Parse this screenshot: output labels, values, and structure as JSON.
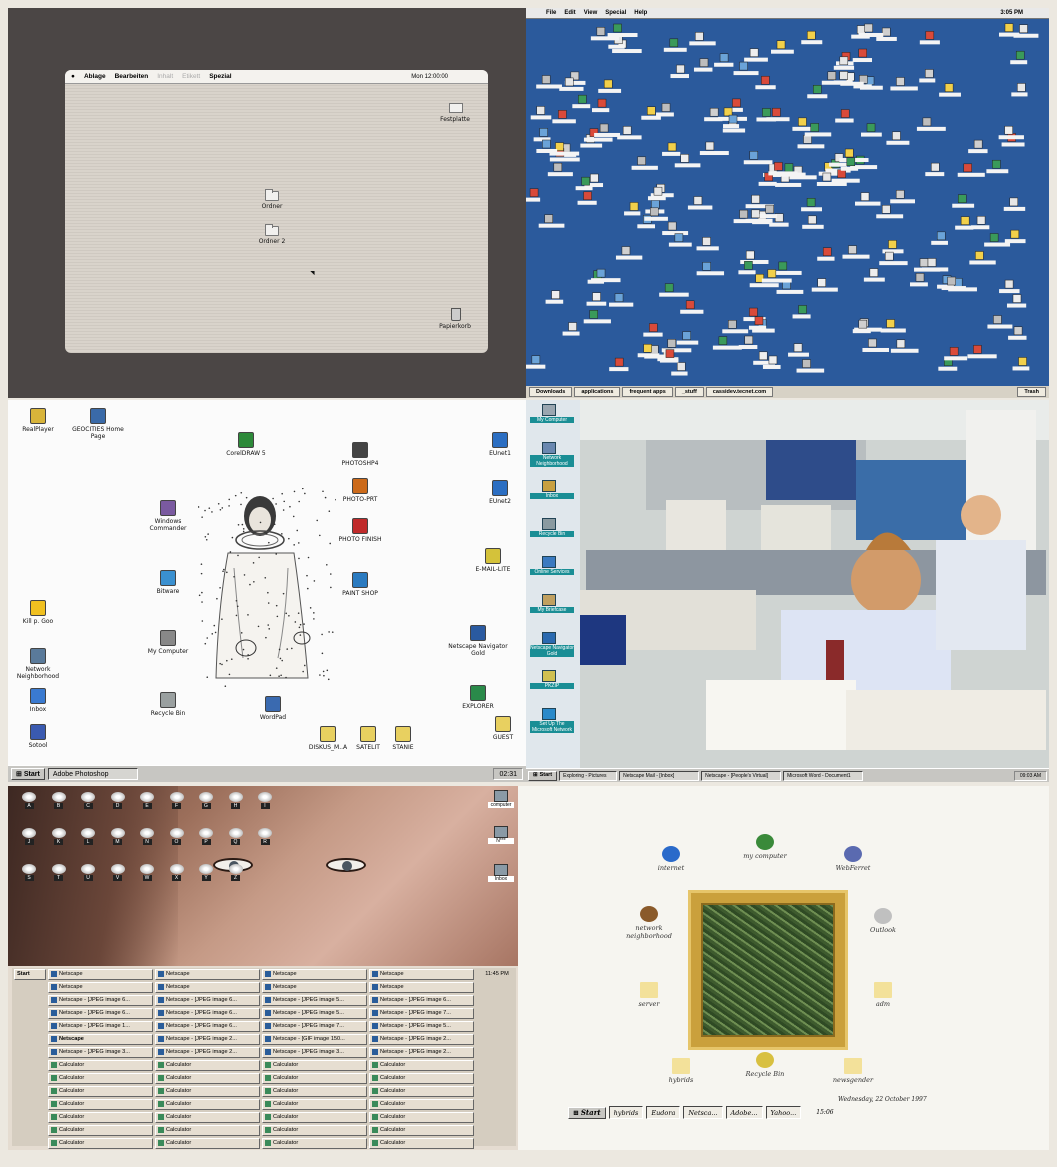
{
  "mac1": {
    "menu": [
      "Ablage",
      "Bearbeiten",
      "Inhalt",
      "Etikett",
      "Spezial"
    ],
    "menu_dim": [
      false,
      false,
      true,
      true,
      false
    ],
    "clock": "Mon 12:00:00",
    "icons": [
      "Festplatte",
      "Ordner",
      "Ordner 2",
      "Papierkorb"
    ]
  },
  "mac2": {
    "menu": [
      "File",
      "Edit",
      "View",
      "Special",
      "Help"
    ],
    "time": "3:05 PM",
    "tabs": [
      "Downloads",
      "applications",
      "frequent apps",
      "_stuff",
      "cassidev.tecnet.com",
      "",
      "",
      "",
      "Trash"
    ],
    "icon_count_estimate": 190
  },
  "win95": {
    "icons": [
      {
        "label": "RealPlayer",
        "icon": "realplayer-icon"
      },
      {
        "label": "GEOCITIES Home Page",
        "icon": "geocities-icon"
      },
      {
        "label": "CorelDRAW 5",
        "icon": "corel-icon"
      },
      {
        "label": "PHOTOSHP4",
        "icon": "photoshop-icon"
      },
      {
        "label": "PHOTO-PRT",
        "icon": "photo-print-icon"
      },
      {
        "label": "EUnet1",
        "icon": "eunet-icon"
      },
      {
        "label": "EUnet2",
        "icon": "eunet-icon"
      },
      {
        "label": "Windows Commander",
        "icon": "windows-commander-icon"
      },
      {
        "label": "PHOTO FINISH",
        "icon": "photo-finish-icon"
      },
      {
        "label": "PAINT SHOP",
        "icon": "paint-shop-icon"
      },
      {
        "label": "E-MAIL-LITE",
        "icon": "email-icon"
      },
      {
        "label": "Bitware",
        "icon": "bitware-icon"
      },
      {
        "label": "Kill p. Goo",
        "icon": "goo-icon"
      },
      {
        "label": "My Computer",
        "icon": "my-computer-icon"
      },
      {
        "label": "Netscape Navigator Gold",
        "icon": "netscape-icon"
      },
      {
        "label": "Network Neighborhood",
        "icon": "network-icon"
      },
      {
        "label": "Inbox",
        "icon": "inbox-icon"
      },
      {
        "label": "Recycle Bin",
        "icon": "recycle-bin-icon"
      },
      {
        "label": "WordPad",
        "icon": "wordpad-icon"
      },
      {
        "label": "EXPLORER",
        "icon": "explorer-icon"
      },
      {
        "label": "Sotool",
        "icon": "sotool-icon"
      },
      {
        "label": "DISKUS_M..A",
        "icon": "folder-icon"
      },
      {
        "label": "SATELIT",
        "icon": "folder-icon"
      },
      {
        "label": "STANIE",
        "icon": "folder-icon"
      },
      {
        "label": "GUEST",
        "icon": "folder-icon"
      }
    ],
    "taskbar": {
      "start": "Start",
      "task": "Adobe Photoshop",
      "clock": "02:31"
    }
  },
  "office": {
    "left_icons": [
      "My Computer",
      "Network Neighborhood",
      "Inbox",
      "Recycle Bin",
      "Online Services",
      "My Briefcase",
      "Netscape Navigator Gold",
      "PKZIP",
      "Set Up The Microsoft Network"
    ],
    "taskbar": {
      "start": "Start",
      "tasks": [
        "Exploring - Pictures",
        "Netscape Mail - [Inbox]",
        "Netscape - [People's Virtual]",
        "Microsoft Word - Document1"
      ],
      "clock": "09:03 AM"
    }
  },
  "face": {
    "cd_letters": [
      "A",
      "B",
      "C",
      "D",
      "E",
      "F",
      "G",
      "H",
      "I",
      "J",
      "K",
      "L",
      "M",
      "N",
      "O",
      "P",
      "Q",
      "R",
      "S",
      "T",
      "U",
      "V",
      "W",
      "X",
      "Y",
      "Z"
    ],
    "right_icons": [
      "computer",
      "N***",
      "Inbox"
    ],
    "taskbar": {
      "start": "Start",
      "clock": "11:45 PM",
      "rows": [
        [
          "Netscape",
          "Netscape",
          "Netscape",
          "Netscape"
        ],
        [
          "Netscape",
          "Netscape",
          "Netscape",
          "Netscape"
        ],
        [
          "Netscape - [JPEG image 6...",
          "Netscape - [JPEG image 6...",
          "Netscape - [JPEG image 5...",
          "Netscape - [JPEG image 6..."
        ],
        [
          "Netscape - [JPEG image 6...",
          "Netscape - [JPEG image 6...",
          "Netscape - [JPEG image 5...",
          "Netscape - [JPEG image 7..."
        ],
        [
          "Netscape - [JPEG image 1...",
          "Netscape - [JPEG image 6...",
          "Netscape - [JPEG image 7...",
          "Netscape - [JPEG image 5..."
        ],
        [
          "Netscape",
          "Netscape - [JPEG image 2...",
          "Netscape - [GIF image 150...",
          "Netscape - [JPEG image 2..."
        ],
        [
          "Netscape - [JPEG image 3...",
          "Netscape - [JPEG image 2...",
          "Netscape - [JPEG image 3...",
          "Netscape - [JPEG image 2..."
        ],
        [
          "Calculator",
          "Calculator",
          "Calculator",
          "Calculator"
        ],
        [
          "Calculator",
          "Calculator",
          "Calculator",
          "Calculator"
        ],
        [
          "Calculator",
          "Calculator",
          "Calculator",
          "Calculator"
        ],
        [
          "Calculator",
          "Calculator",
          "Calculator",
          "Calculator"
        ],
        [
          "Calculator",
          "Calculator",
          "Calculator",
          "Calculator"
        ],
        [
          "Calculator",
          "Calculator",
          "Calculator",
          "Calculator"
        ],
        [
          "Calculator",
          "Calculator",
          "Calculator",
          "Calculator"
        ]
      ]
    }
  },
  "circle": {
    "icons": [
      {
        "label": "internet",
        "icon": "internet-icon"
      },
      {
        "label": "my computer",
        "icon": "my-computer-icon"
      },
      {
        "label": "WebFerret",
        "icon": "webferret-icon"
      },
      {
        "label": "network neighborhood",
        "icon": "network-icon"
      },
      {
        "label": "Outlook",
        "icon": "outlook-icon"
      },
      {
        "label": "server",
        "icon": "folder-icon"
      },
      {
        "label": "adm",
        "icon": "folder-icon"
      },
      {
        "label": "hybrids",
        "icon": "folder-icon"
      },
      {
        "label": "Recycle Bin",
        "icon": "recycle-bin-icon"
      },
      {
        "label": "newsgender",
        "icon": "folder-icon"
      }
    ],
    "date": "Wednesday, 22 October 1997",
    "taskbar": {
      "start": "Start",
      "tasks": [
        "hybrids",
        "Eudora",
        "Netsca...",
        "Adobe...",
        "Yahoo..."
      ],
      "clock": "15:06"
    }
  },
  "colors": {
    "mac2_bg": "#2b5a9c",
    "office_teal": "#1a8e95",
    "frame_gold": "#caa03c"
  }
}
